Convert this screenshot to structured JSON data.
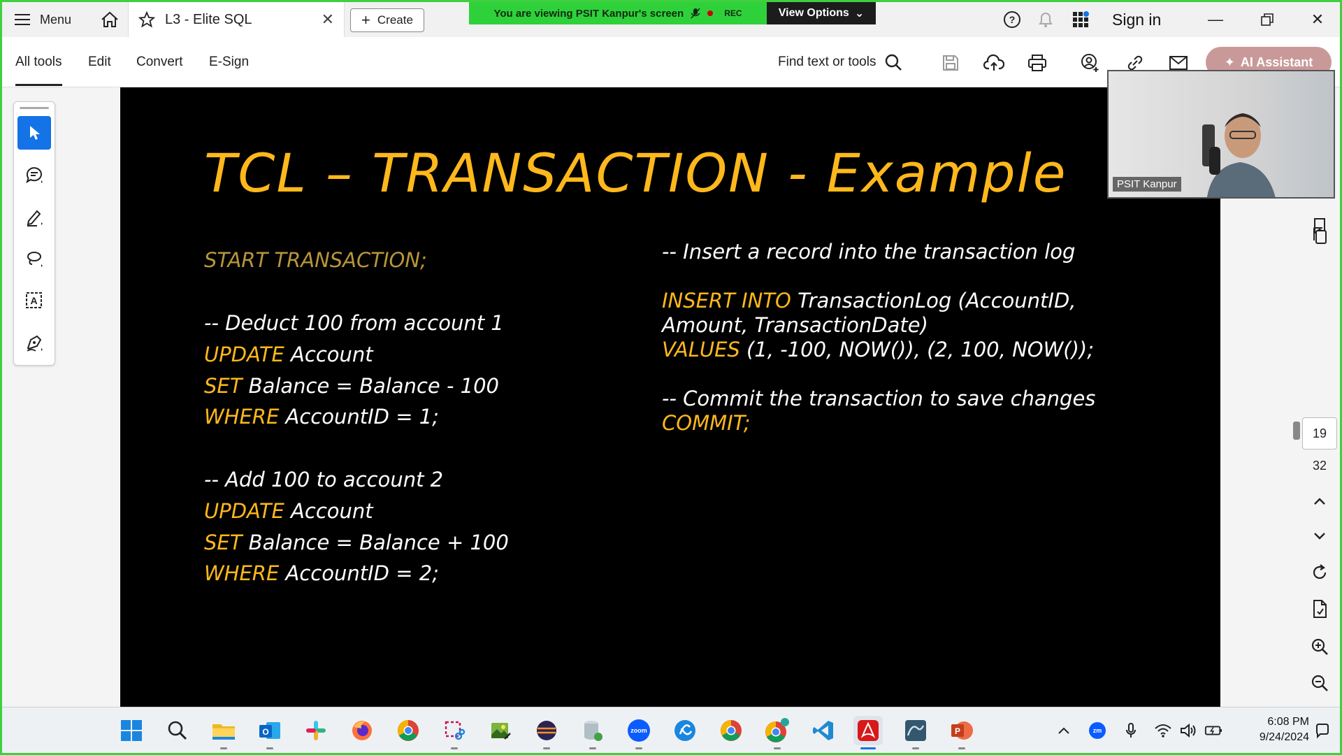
{
  "tabbar": {
    "menu_label": "Menu",
    "tab_title": "L3 - Elite SQL",
    "create_label": "Create",
    "viewing_text": "You are viewing PSIT Kanpur's screen",
    "rec_label": "REC",
    "view_options_label": "View Options",
    "sign_in_label": "Sign in"
  },
  "toolbar": {
    "tabs": [
      {
        "label": "All tools"
      },
      {
        "label": "Edit"
      },
      {
        "label": "Convert"
      },
      {
        "label": "E-Sign"
      }
    ],
    "find_label": "Find text or tools",
    "ai_label": "AI Assistant"
  },
  "slide": {
    "title": "TCL – TRANSACTION - Example",
    "left": {
      "start": "START TRANSACTION;",
      "c1": "-- Deduct 100 from account 1",
      "b1_l1_kw": "UPDATE",
      "b1_l1_rest": " Account",
      "b1_l2_kw": "SET",
      "b1_l2_rest": " Balance = Balance - 100",
      "b1_l3_kw": "WHERE",
      "b1_l3_rest": " AccountID = 1;",
      "c2": "-- Add 100 to account 2",
      "b2_l1_kw": "UPDATE",
      "b2_l1_rest": " Account",
      "b2_l2_kw": "SET",
      "b2_l2_rest": " Balance = Balance + 100",
      "b2_l3_kw": "WHERE",
      "b2_l3_rest": " AccountID = 2;"
    },
    "right": {
      "c1": "-- Insert a record into the transaction log",
      "ins_kw": "INSERT INTO",
      "ins_rest": " TransactionLog (AccountID,",
      "ins_l2": "Amount, TransactionDate)",
      "val_kw": "VALUES",
      "val_rest": " (1, -100, NOW()), (2, 100, NOW());",
      "c2": "-- Commit the transaction to save changes",
      "commit": "COMMIT;"
    }
  },
  "pager": {
    "current": "19",
    "total": "32"
  },
  "video": {
    "name": "PSIT Kanpur"
  },
  "taskbar": {
    "time": "6:08 PM",
    "date": "9/24/2024",
    "zoom_label": "zoom",
    "zm_label": "zm"
  },
  "colors": {
    "accent": "#1473e6",
    "slide_keyword": "#ffb81c",
    "share_border": "#3fcf3f"
  }
}
